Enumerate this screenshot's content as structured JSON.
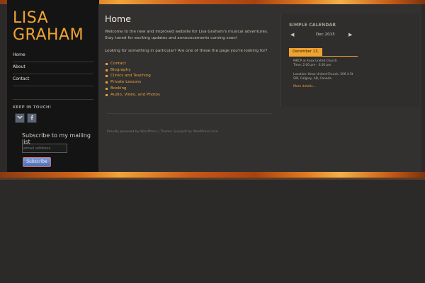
{
  "site": {
    "title_line1": "LISA",
    "title_line2": "GRAHAM"
  },
  "nav": {
    "items": [
      "Home",
      "About",
      "Contact"
    ]
  },
  "sidebar": {
    "keep_in_touch": "KEEP IN TOUCH!",
    "social_icons": [
      "twitter-icon",
      "facebook-icon"
    ],
    "subscribe_title": "Subscribe to my mailing list",
    "email_placeholder": "email address",
    "subscribe_button": "Subscribe"
  },
  "page": {
    "title": "Home",
    "intro": "Welcome to the new and improved website for Lisa Graham's musical adventures. Stay tuned for exciting updates and announcements coming soon!",
    "question": "Looking for something in particular? Are one of these the page you're looking for?",
    "links": [
      "Contact",
      "Biography",
      "Clinics and Teaching",
      "Private Lessons",
      "Booking",
      "Audio, Video, and Photos"
    ]
  },
  "calendar": {
    "heading": "SIMPLE CALENDAR",
    "prev": "◀",
    "month": "Dec 2015",
    "next": "▶",
    "selected_date": "December 13, 2015",
    "event_title": "MRCP at Knox United Church",
    "event_time": "Time: 2:00 pm - 3:00 pm",
    "event_location": "Location: Knox United Church, 506 4 St SW, Calgary, AB, Canada",
    "more_details": "More details..."
  },
  "footer": {
    "credits": "Proudly powered by WordPress | Theme: Sunspot by WordPress.com."
  },
  "colors": {
    "accent": "#f0a430",
    "background": "#2b2a29",
    "sidebar": "#141414"
  }
}
